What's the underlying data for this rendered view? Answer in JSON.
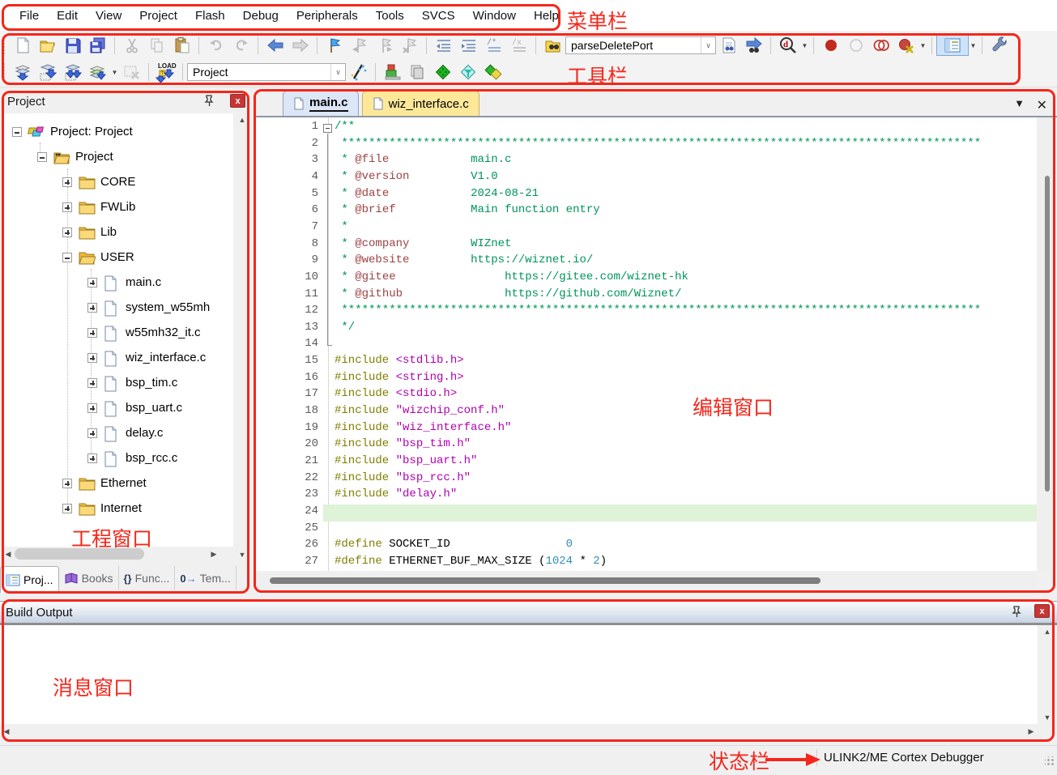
{
  "menu": {
    "items": [
      "File",
      "Edit",
      "View",
      "Project",
      "Flash",
      "Debug",
      "Peripherals",
      "Tools",
      "SVCS",
      "Window",
      "Help"
    ]
  },
  "toolbar": {
    "row1": [
      {
        "icon": "new-file-icon"
      },
      {
        "icon": "open-file-icon"
      },
      {
        "icon": "save-icon"
      },
      {
        "icon": "save-all-icon"
      },
      {
        "sep": true
      },
      {
        "icon": "cut-icon"
      },
      {
        "icon": "copy-icon"
      },
      {
        "icon": "paste-icon"
      },
      {
        "sep": true
      },
      {
        "icon": "undo-icon"
      },
      {
        "icon": "redo-icon"
      },
      {
        "sep": true
      },
      {
        "icon": "navigate-back-icon"
      },
      {
        "icon": "navigate-forward-icon"
      },
      {
        "sep": true
      },
      {
        "icon": "bookmark-toggle-icon"
      },
      {
        "icon": "bookmark-prev-icon"
      },
      {
        "icon": "bookmark-next-icon"
      },
      {
        "icon": "bookmark-clear-icon"
      },
      {
        "sep": true
      },
      {
        "icon": "indent-left-icon"
      },
      {
        "icon": "indent-right-icon"
      },
      {
        "icon": "comment-icon"
      },
      {
        "icon": "uncomment-icon"
      },
      {
        "sep": true
      },
      {
        "icon": "find-in-files-icon"
      },
      {
        "combo": "find_text"
      },
      {
        "icon": "find-document-icon"
      },
      {
        "icon": "incremental-find-icon"
      },
      {
        "sep": true
      },
      {
        "icon": "quick-find-icon"
      },
      {
        "caret": true
      },
      {
        "sep": true
      },
      {
        "icon": "breakpoint-insert-icon"
      },
      {
        "icon": "breakpoint-enable-icon"
      },
      {
        "icon": "breakpoint-disable-all-icon"
      },
      {
        "icon": "breakpoint-kill-all-icon"
      },
      {
        "caret": true
      },
      {
        "sep": true
      },
      {
        "winbtn": true
      },
      {
        "caret": true
      },
      {
        "sep": true
      },
      {
        "icon": "configure-wrench-icon"
      }
    ],
    "row2": [
      {
        "icon": "translate-icon"
      },
      {
        "icon": "build-icon"
      },
      {
        "icon": "rebuild-icon"
      },
      {
        "icon": "batch-build-icon"
      },
      {
        "caret": true
      },
      {
        "icon": "stop-build-icon"
      },
      {
        "sep": true
      },
      {
        "icon": "load-flash-icon"
      },
      {
        "sep": true
      },
      {
        "combo": "target_select"
      },
      {
        "icon": "target-options-icon"
      },
      {
        "sep": true
      },
      {
        "icon": "manage-components-icon"
      },
      {
        "icon": "manage-books-icon"
      },
      {
        "icon": "select-packs-icon"
      },
      {
        "icon": "run-time-env-icon"
      },
      {
        "icon": "pack-installer-icon"
      }
    ],
    "find_text": "parseDeletePort",
    "target_select": "Project"
  },
  "project_panel": {
    "title": "Project",
    "tree": [
      {
        "label": "Project: Project",
        "level": 0,
        "exp": "minus",
        "icon": "target-icon"
      },
      {
        "label": "Project",
        "level": 1,
        "exp": "minus",
        "icon": "project-folder-icon"
      },
      {
        "label": "CORE",
        "level": 2,
        "exp": "plus",
        "icon": "folder-icon"
      },
      {
        "label": "FWLib",
        "level": 2,
        "exp": "plus",
        "icon": "folder-icon"
      },
      {
        "label": "Lib",
        "level": 2,
        "exp": "plus",
        "icon": "folder-icon"
      },
      {
        "label": "USER",
        "level": 2,
        "exp": "minus",
        "icon": "folder-open-icon"
      },
      {
        "label": "main.c",
        "level": 3,
        "exp": "plus",
        "icon": "file-icon"
      },
      {
        "label": "system_w55mh",
        "level": 3,
        "exp": "plus",
        "icon": "file-icon"
      },
      {
        "label": "w55mh32_it.c",
        "level": 3,
        "exp": "plus",
        "icon": "file-icon"
      },
      {
        "label": "wiz_interface.c",
        "level": 3,
        "exp": "plus",
        "icon": "file-icon"
      },
      {
        "label": "bsp_tim.c",
        "level": 3,
        "exp": "plus",
        "icon": "file-icon"
      },
      {
        "label": "bsp_uart.c",
        "level": 3,
        "exp": "plus",
        "icon": "file-icon"
      },
      {
        "label": "delay.c",
        "level": 3,
        "exp": "plus",
        "icon": "file-icon"
      },
      {
        "label": "bsp_rcc.c",
        "level": 3,
        "exp": "plus",
        "icon": "file-icon"
      },
      {
        "label": "Ethernet",
        "level": 2,
        "exp": "plus",
        "icon": "folder-icon"
      },
      {
        "label": "Internet",
        "level": 2,
        "exp": "plus",
        "icon": "folder-icon"
      }
    ],
    "tabs": [
      {
        "label": "Proj...",
        "icon": "project-tab-icon",
        "active": true
      },
      {
        "label": "Books",
        "icon": "books-tab-icon"
      },
      {
        "label": "Func...",
        "icon": "functions-tab-icon"
      },
      {
        "label": "Tem...",
        "icon": "templates-tab-icon"
      }
    ]
  },
  "editor": {
    "tabs": [
      {
        "label": "main.c",
        "active": true
      },
      {
        "label": "wiz_interface.c",
        "active": false
      }
    ],
    "code": [
      {
        "n": 1,
        "segs": [
          [
            "/**",
            "c"
          ]
        ]
      },
      {
        "n": 2,
        "segs": [
          [
            " **********************************************************************************************",
            "c"
          ]
        ]
      },
      {
        "n": 3,
        "segs": [
          [
            " * ",
            "c"
          ],
          [
            "@file",
            "d"
          ],
          [
            "            ",
            "c"
          ],
          [
            "main.c",
            "c"
          ]
        ]
      },
      {
        "n": 4,
        "segs": [
          [
            " * ",
            "c"
          ],
          [
            "@version",
            "d"
          ],
          [
            "         ",
            "c"
          ],
          [
            "V1.0",
            "c"
          ]
        ]
      },
      {
        "n": 5,
        "segs": [
          [
            " * ",
            "c"
          ],
          [
            "@date",
            "d"
          ],
          [
            "            ",
            "c"
          ],
          [
            "2024-08-21",
            "c"
          ]
        ]
      },
      {
        "n": 6,
        "segs": [
          [
            " * ",
            "c"
          ],
          [
            "@brief",
            "d"
          ],
          [
            "           ",
            "c"
          ],
          [
            "Main function entry",
            "c"
          ]
        ]
      },
      {
        "n": 7,
        "segs": [
          [
            " *",
            "c"
          ]
        ]
      },
      {
        "n": 8,
        "segs": [
          [
            " * ",
            "c"
          ],
          [
            "@company",
            "d"
          ],
          [
            "         ",
            "c"
          ],
          [
            "WIZnet",
            "c"
          ]
        ]
      },
      {
        "n": 9,
        "segs": [
          [
            " * ",
            "c"
          ],
          [
            "@website",
            "d"
          ],
          [
            "         ",
            "c"
          ],
          [
            "https://wiznet.io/",
            "c"
          ]
        ]
      },
      {
        "n": 10,
        "segs": [
          [
            " * ",
            "c"
          ],
          [
            "@gitee",
            "d"
          ],
          [
            "                ",
            "c"
          ],
          [
            "https://gitee.com/wiznet-hk",
            "c"
          ]
        ]
      },
      {
        "n": 11,
        "segs": [
          [
            " * ",
            "c"
          ],
          [
            "@github",
            "d"
          ],
          [
            "               ",
            "c"
          ],
          [
            "https://github.com/Wiznet/",
            "c"
          ]
        ]
      },
      {
        "n": 12,
        "segs": [
          [
            " **********************************************************************************************",
            "c"
          ]
        ]
      },
      {
        "n": 13,
        "segs": [
          [
            " */",
            "c"
          ]
        ]
      },
      {
        "n": 14,
        "segs": []
      },
      {
        "n": 15,
        "segs": [
          [
            "#include",
            "p"
          ],
          [
            " ",
            "k"
          ],
          [
            "<stdlib.h>",
            "s"
          ]
        ]
      },
      {
        "n": 16,
        "segs": [
          [
            "#include",
            "p"
          ],
          [
            " ",
            "k"
          ],
          [
            "<string.h>",
            "s"
          ]
        ]
      },
      {
        "n": 17,
        "segs": [
          [
            "#include",
            "p"
          ],
          [
            " ",
            "k"
          ],
          [
            "<stdio.h>",
            "s"
          ]
        ]
      },
      {
        "n": 18,
        "segs": [
          [
            "#include",
            "p"
          ],
          [
            " ",
            "k"
          ],
          [
            "\"wizchip_conf.h\"",
            "s"
          ]
        ]
      },
      {
        "n": 19,
        "segs": [
          [
            "#include",
            "p"
          ],
          [
            " ",
            "k"
          ],
          [
            "\"wiz_interface.h\"",
            "s"
          ]
        ]
      },
      {
        "n": 20,
        "segs": [
          [
            "#include",
            "p"
          ],
          [
            " ",
            "k"
          ],
          [
            "\"bsp_tim.h\"",
            "s"
          ]
        ]
      },
      {
        "n": 21,
        "segs": [
          [
            "#include",
            "p"
          ],
          [
            " ",
            "k"
          ],
          [
            "\"bsp_uart.h\"",
            "s"
          ]
        ]
      },
      {
        "n": 22,
        "segs": [
          [
            "#include",
            "p"
          ],
          [
            " ",
            "k"
          ],
          [
            "\"bsp_rcc.h\"",
            "s"
          ]
        ]
      },
      {
        "n": 23,
        "segs": [
          [
            "#include",
            "p"
          ],
          [
            " ",
            "k"
          ],
          [
            "\"delay.h\"",
            "s"
          ]
        ]
      },
      {
        "n": 24,
        "segs": [],
        "hl": true
      },
      {
        "n": 25,
        "segs": []
      },
      {
        "n": 26,
        "segs": [
          [
            "#define",
            "p"
          ],
          [
            " ",
            "k"
          ],
          [
            "SOCKET_ID",
            "k"
          ],
          [
            "                 ",
            "k"
          ],
          [
            "0",
            "n"
          ]
        ]
      },
      {
        "n": 27,
        "segs": [
          [
            "#define",
            "p"
          ],
          [
            " ",
            "k"
          ],
          [
            "ETHERNET_BUF_MAX_SIZE",
            "k"
          ],
          [
            " (",
            "k"
          ],
          [
            "1024",
            "n"
          ],
          [
            " * ",
            "k"
          ],
          [
            "2",
            "n"
          ],
          [
            ")",
            "k"
          ]
        ]
      }
    ]
  },
  "build_output": {
    "title": "Build Output"
  },
  "statusbar": {
    "debugger": "ULINK2/ME Cortex Debugger"
  },
  "annotations": {
    "menu": "菜单栏",
    "toolbar": "工具栏",
    "editor": "编辑窗口",
    "project": "工程窗口",
    "messages": "消息窗口",
    "status": "状态栏"
  }
}
